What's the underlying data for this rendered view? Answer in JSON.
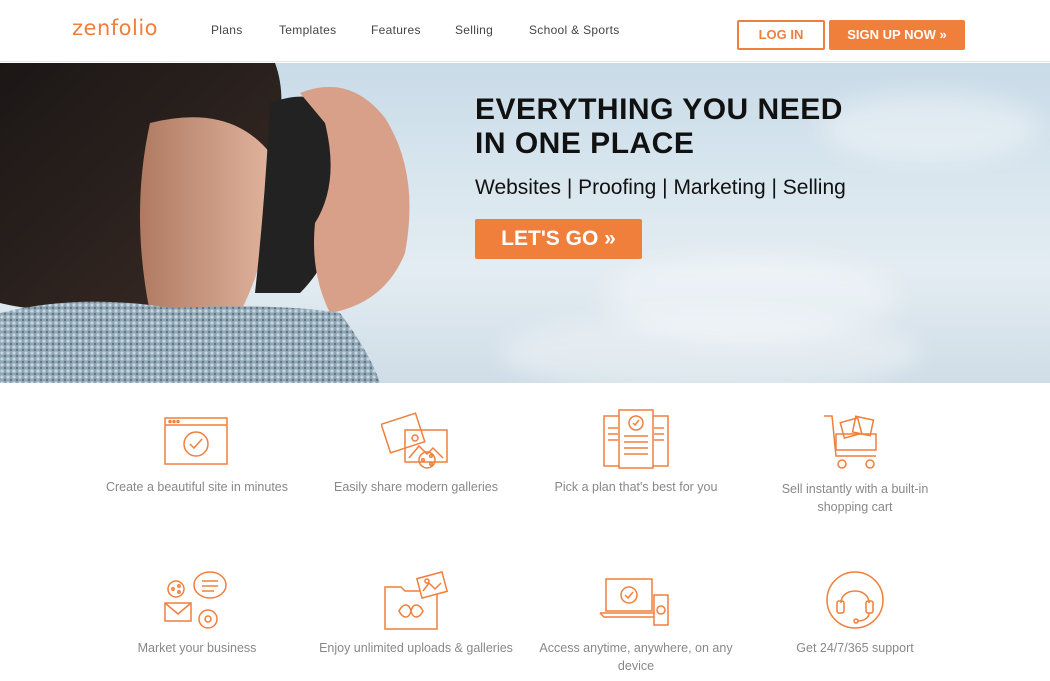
{
  "brand": {
    "logo": "zenfolio",
    "accent": "#f07f3c"
  },
  "nav": {
    "items": [
      {
        "label": "Plans"
      },
      {
        "label": "Templates"
      },
      {
        "label": "Features"
      },
      {
        "label": "Selling"
      },
      {
        "label": "School & Sports"
      }
    ],
    "login_label": "LOG IN",
    "signup_label": "SIGN UP NOW »"
  },
  "hero": {
    "headline_line1": "EVERYTHING YOU NEED",
    "headline_line2": "IN ONE PLACE",
    "subline": "Websites | Proofing | Marketing | Selling",
    "cta_label": "LET'S GO »"
  },
  "features": [
    {
      "icon": "browser-check-icon",
      "caption": "Create a beautiful site in minutes"
    },
    {
      "icon": "photo-share-icon",
      "caption": "Easily share modern galleries"
    },
    {
      "icon": "plan-documents-icon",
      "caption": "Pick a plan that's best for you"
    },
    {
      "icon": "shopping-cart-icon",
      "caption": "Sell instantly with a built-in shopping cart"
    },
    {
      "icon": "marketing-icon",
      "caption": "Market your business"
    },
    {
      "icon": "folder-infinity-icon",
      "caption": "Enjoy unlimited uploads & galleries"
    },
    {
      "icon": "devices-icon",
      "caption": "Access anytime, anywhere, on any device"
    },
    {
      "icon": "headset-support-icon",
      "caption": "Get 24/7/365 support"
    }
  ]
}
